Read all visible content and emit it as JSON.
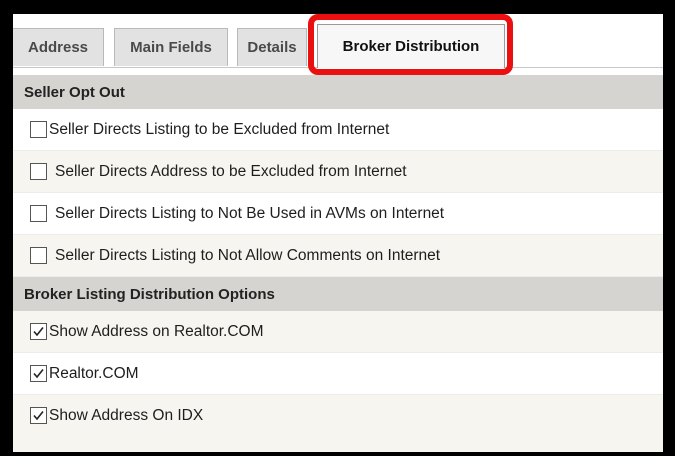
{
  "tabs": [
    {
      "label": "Address"
    },
    {
      "label": "Main Fields"
    },
    {
      "label": "Details"
    },
    {
      "label": "Broker Distribution",
      "active": true
    }
  ],
  "seller_opt_out": {
    "header": "Seller Opt Out",
    "items": [
      {
        "label": "Seller Directs Listing to be Excluded from Internet",
        "checked": false
      },
      {
        "label": "Seller Directs Address to be Excluded from Internet",
        "checked": false
      },
      {
        "label": "Seller Directs Listing to Not Be Used in AVMs on Internet",
        "checked": false
      },
      {
        "label": "Seller Directs Listing to Not Allow Comments on Internet",
        "checked": false
      }
    ]
  },
  "broker_distribution": {
    "header": "Broker Listing Distribution Options",
    "items": [
      {
        "label": "Show Address on Realtor.COM",
        "checked": true
      },
      {
        "label": "Realtor.COM",
        "checked": true
      },
      {
        "label": "Show Address On IDX",
        "checked": true
      }
    ]
  },
  "colors": {
    "highlight": "#ea1010",
    "section_header_bg": "#d6d4d0",
    "alt_row_bg": "#f6f5f0"
  }
}
